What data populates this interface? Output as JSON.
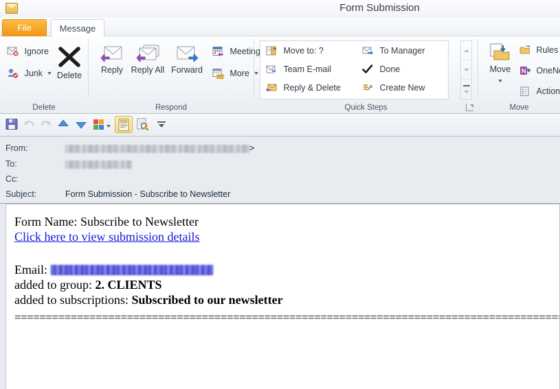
{
  "window": {
    "title": "Form Submission",
    "icon": "envelope-icon"
  },
  "tabs": [
    {
      "id": "file",
      "label": "File",
      "active": false,
      "color": "#f0941a"
    },
    {
      "id": "message",
      "label": "Message",
      "active": true
    }
  ],
  "ribbon": {
    "groups": [
      {
        "id": "delete",
        "label": "Delete",
        "small_buttons": [
          {
            "label": "Ignore",
            "icon": "ignore-icon",
            "caret": false
          },
          {
            "label": "Junk",
            "icon": "junk-icon",
            "caret": true
          }
        ],
        "big_buttons": [
          {
            "label": "Delete",
            "icon": "delete-x-icon"
          }
        ]
      },
      {
        "id": "respond",
        "label": "Respond",
        "big_buttons": [
          {
            "label": "Reply",
            "icon": "reply-icon"
          },
          {
            "label": "Reply All",
            "icon": "reply-all-icon"
          },
          {
            "label": "Forward",
            "icon": "forward-icon"
          }
        ],
        "small_buttons": [
          {
            "label": "Meeting",
            "icon": "meeting-icon",
            "caret": false
          },
          {
            "label": "More",
            "icon": "more-respond-icon",
            "caret": true
          }
        ]
      },
      {
        "id": "quick-steps",
        "label": "Quick Steps",
        "items": [
          {
            "label": "Move to: ?",
            "icon": "move-to-icon"
          },
          {
            "label": "To Manager",
            "icon": "to-manager-icon"
          },
          {
            "label": "Team E-mail",
            "icon": "team-email-icon"
          },
          {
            "label": "Done",
            "icon": "done-check-icon"
          },
          {
            "label": "Reply & Delete",
            "icon": "reply-delete-icon"
          },
          {
            "label": "Create New",
            "icon": "create-new-icon"
          }
        ],
        "has_dialog_launcher": true
      },
      {
        "id": "move",
        "label": "Move",
        "big_buttons": [
          {
            "label": "Move",
            "icon": "move-folder-icon",
            "caret": true
          }
        ],
        "small_buttons": [
          {
            "label": "Rules",
            "icon": "rules-icon",
            "caret": true
          },
          {
            "label": "OneNo",
            "icon": "onenote-icon",
            "caret": false
          },
          {
            "label": "Actions",
            "icon": "actions-icon",
            "caret": false
          }
        ]
      }
    ]
  },
  "quick_access_toolbar": {
    "items": [
      {
        "id": "save",
        "icon": "save-floppy-icon",
        "enabled": true
      },
      {
        "id": "undo",
        "icon": "undo-arrow-icon",
        "enabled": false
      },
      {
        "id": "redo",
        "icon": "redo-arrow-icon",
        "enabled": false
      },
      {
        "id": "previous",
        "icon": "up-arrow-icon",
        "enabled": true
      },
      {
        "id": "next",
        "icon": "down-arrow-icon",
        "enabled": true
      },
      {
        "id": "categorize",
        "icon": "color-squares-icon",
        "enabled": true,
        "caret": true
      },
      {
        "id": "message-view",
        "icon": "notepad-icon",
        "enabled": true,
        "selected": true
      },
      {
        "id": "print-preview",
        "icon": "print-preview-icon",
        "enabled": true
      },
      {
        "id": "customize",
        "icon": "customize-chevron-icon",
        "enabled": true
      }
    ]
  },
  "message_header": {
    "fields": [
      {
        "id": "from",
        "label": "From:",
        "value": "",
        "redacted": true,
        "redacted_width": 268,
        "suffix": ">"
      },
      {
        "id": "to",
        "label": "To:",
        "value": "",
        "redacted": true,
        "redacted_width": 97,
        "suffix": ""
      },
      {
        "id": "cc",
        "label": "Cc:",
        "value": "",
        "redacted": false,
        "suffix": ""
      },
      {
        "id": "subject",
        "label": "Subject:",
        "value": "Form Submission - Subscribe to Newsletter",
        "redacted": false,
        "suffix": ""
      }
    ]
  },
  "message_body": {
    "form_name_line": "Form Name: Subscribe to Newsletter",
    "details_link": "Click here to view submission details",
    "email_label": "Email:",
    "email_value_redacted": true,
    "email_redacted_width": 236,
    "group_label": "added to group:",
    "group_value": "2. CLIENTS",
    "subscriptions_label": "added to subscriptions:",
    "subscriptions_value": "Subscribed to our newsletter",
    "separator": "========================================================================================================================================="
  }
}
